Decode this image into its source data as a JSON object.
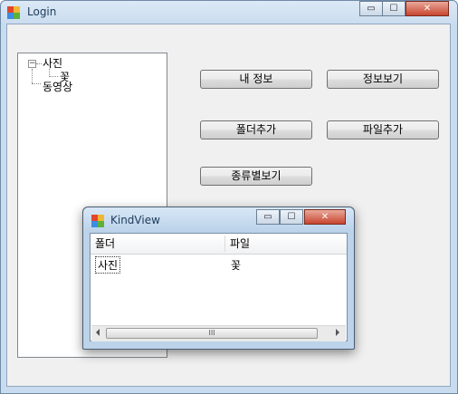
{
  "main_window": {
    "title": "Login",
    "caption_buttons": {
      "minimize": "▭",
      "maximize": "☐",
      "close": "✕"
    }
  },
  "tree": {
    "root": "사진",
    "root_expander": "−",
    "child": "꽃",
    "sibling": "동영상"
  },
  "buttons": {
    "my_info": "내 정보",
    "view_info": "정보보기",
    "add_folder": "폴더추가",
    "add_file": "파일추가",
    "view_by_kind": "종류별보기"
  },
  "dialog": {
    "title": "KindView",
    "caption_buttons": {
      "minimize": "▭",
      "maximize": "☐",
      "close": "✕"
    },
    "columns": [
      "폴더",
      "파일"
    ],
    "rows": [
      {
        "folder": "사진",
        "file": "꽃"
      }
    ],
    "scrollbar_grip": "III"
  }
}
